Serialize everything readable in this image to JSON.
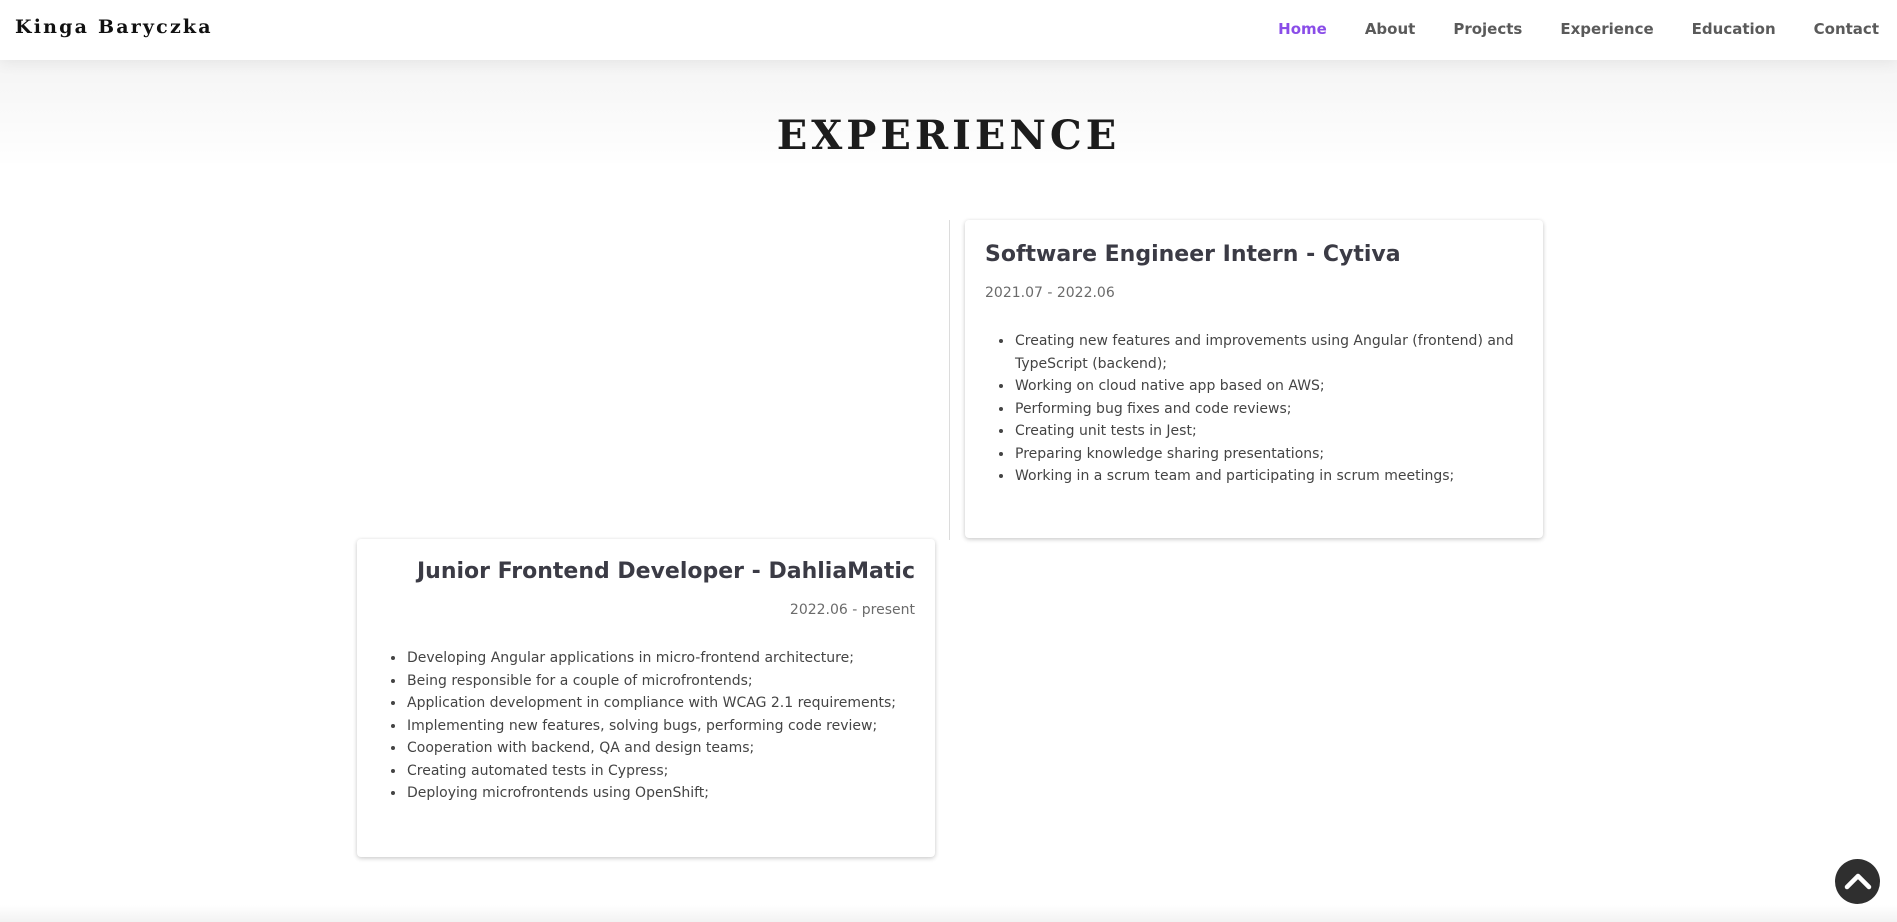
{
  "header": {
    "brand": "Kinga Baryczka",
    "nav": [
      {
        "label": "Home",
        "active": true
      },
      {
        "label": "About",
        "active": false
      },
      {
        "label": "Projects",
        "active": false
      },
      {
        "label": "Experience",
        "active": false
      },
      {
        "label": "Education",
        "active": false
      },
      {
        "label": "Contact",
        "active": false
      }
    ]
  },
  "section": {
    "title": "EXPERIENCE"
  },
  "experience": [
    {
      "title": "Software Engineer Intern - Cytiva",
      "date": "2021.07 - 2022.06",
      "items": [
        "Creating new features and improvements using Angular (frontend) and TypeScript (backend);",
        "Working on cloud native app based on AWS;",
        "Performing bug fixes and code reviews;",
        "Creating unit tests in Jest;",
        "Preparing knowledge sharing presentations;",
        "Working in a scrum team and participating in scrum meetings;"
      ]
    },
    {
      "title": "Junior Frontend Developer - DahliaMatic",
      "date": "2022.06 - present",
      "items": [
        "Developing Angular applications in micro-frontend architecture;",
        "Being responsible for a couple of microfrontends;",
        "Application development in compliance with WCAG 2.1 requirements;",
        "Implementing new features, solving bugs, performing code review;",
        "Cooperation with backend, QA and design teams;",
        "Creating automated tests in Cypress;",
        "Deploying microfrontends using OpenShift;"
      ]
    }
  ],
  "scroll_top": {
    "icon": "chevron-up-icon"
  },
  "colors": {
    "accent": "#8a4de8",
    "nav_text": "#5a5a5a",
    "card_title": "#3b3b45",
    "scroll_button": "#2f2f2f"
  }
}
